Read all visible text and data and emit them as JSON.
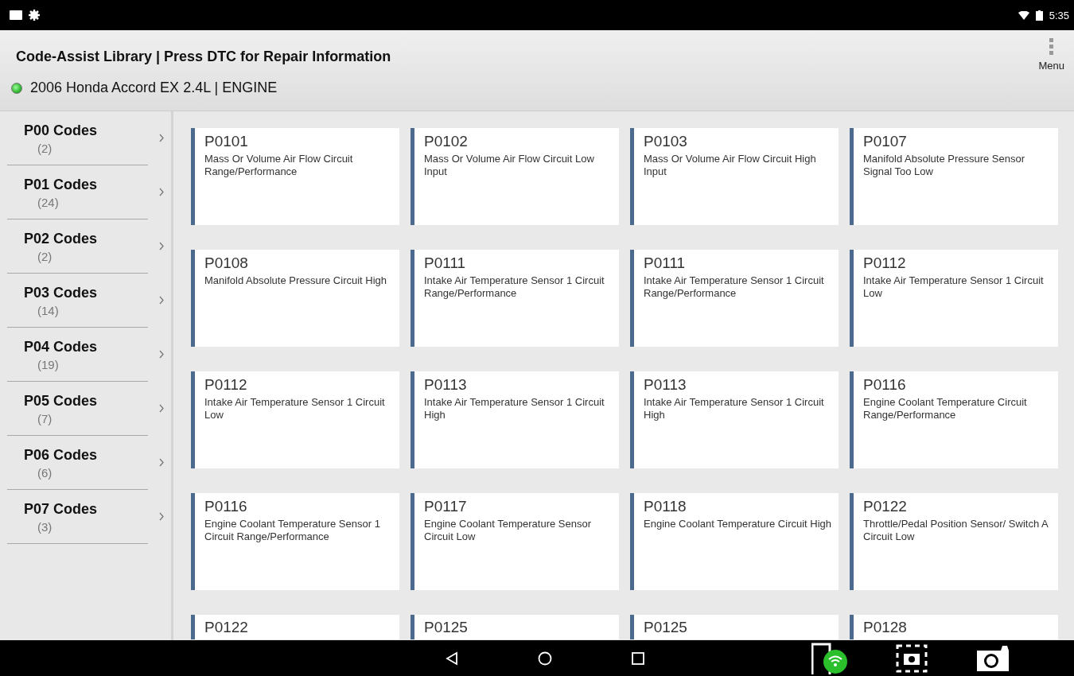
{
  "status_bar": {
    "time": "5:35"
  },
  "header": {
    "title": "Code-Assist Library | Press DTC for Repair Information",
    "menu_label": "Menu",
    "vehicle": "2006 Honda Accord EX 2.4L | ENGINE",
    "connected": true
  },
  "sidebar": {
    "items": [
      {
        "label": "P00 Codes",
        "count": "(2)"
      },
      {
        "label": "P01 Codes",
        "count": "(24)"
      },
      {
        "label": "P02 Codes",
        "count": "(2)"
      },
      {
        "label": "P03 Codes",
        "count": "(14)"
      },
      {
        "label": "P04 Codes",
        "count": "(19)"
      },
      {
        "label": "P05 Codes",
        "count": "(7)"
      },
      {
        "label": "P06 Codes",
        "count": "(6)"
      },
      {
        "label": "P07 Codes",
        "count": "(3)"
      }
    ]
  },
  "codes": [
    {
      "code": "P0101",
      "description": "Mass Or Volume Air Flow Circuit Range/Performance"
    },
    {
      "code": "P0102",
      "description": "Mass Or Volume Air Flow Circuit Low Input"
    },
    {
      "code": "P0103",
      "description": "Mass Or Volume Air Flow Circuit High Input"
    },
    {
      "code": "P0107",
      "description": "Manifold Absolute Pressure Sensor Signal Too Low"
    },
    {
      "code": "P0108",
      "description": "Manifold Absolute Pressure Circuit High"
    },
    {
      "code": "P0111",
      "description": "Intake Air Temperature Sensor 1 Circuit Range/Performance"
    },
    {
      "code": "P0111",
      "description": "Intake Air Temperature Sensor 1 Circuit Range/Performance"
    },
    {
      "code": "P0112",
      "description": "Intake Air Temperature Sensor 1 Circuit Low"
    },
    {
      "code": "P0112",
      "description": "Intake Air Temperature Sensor 1 Circuit Low"
    },
    {
      "code": "P0113",
      "description": "Intake Air Temperature Sensor 1 Circuit High"
    },
    {
      "code": "P0113",
      "description": "Intake Air Temperature Sensor 1 Circuit High"
    },
    {
      "code": "P0116",
      "description": "Engine Coolant Temperature Circuit Range/Performance"
    },
    {
      "code": "P0116",
      "description": "Engine Coolant Temperature Sensor 1 Circuit Range/Performance"
    },
    {
      "code": "P0117",
      "description": "Engine Coolant Temperature Sensor Circuit Low"
    },
    {
      "code": "P0118",
      "description": "Engine Coolant Temperature Circuit High"
    },
    {
      "code": "P0122",
      "description": "Throttle/Pedal Position Sensor/ Switch A Circuit Low"
    },
    {
      "code": "P0122"
    },
    {
      "code": "P0125"
    },
    {
      "code": "P0125"
    },
    {
      "code": "P0128"
    }
  ]
}
